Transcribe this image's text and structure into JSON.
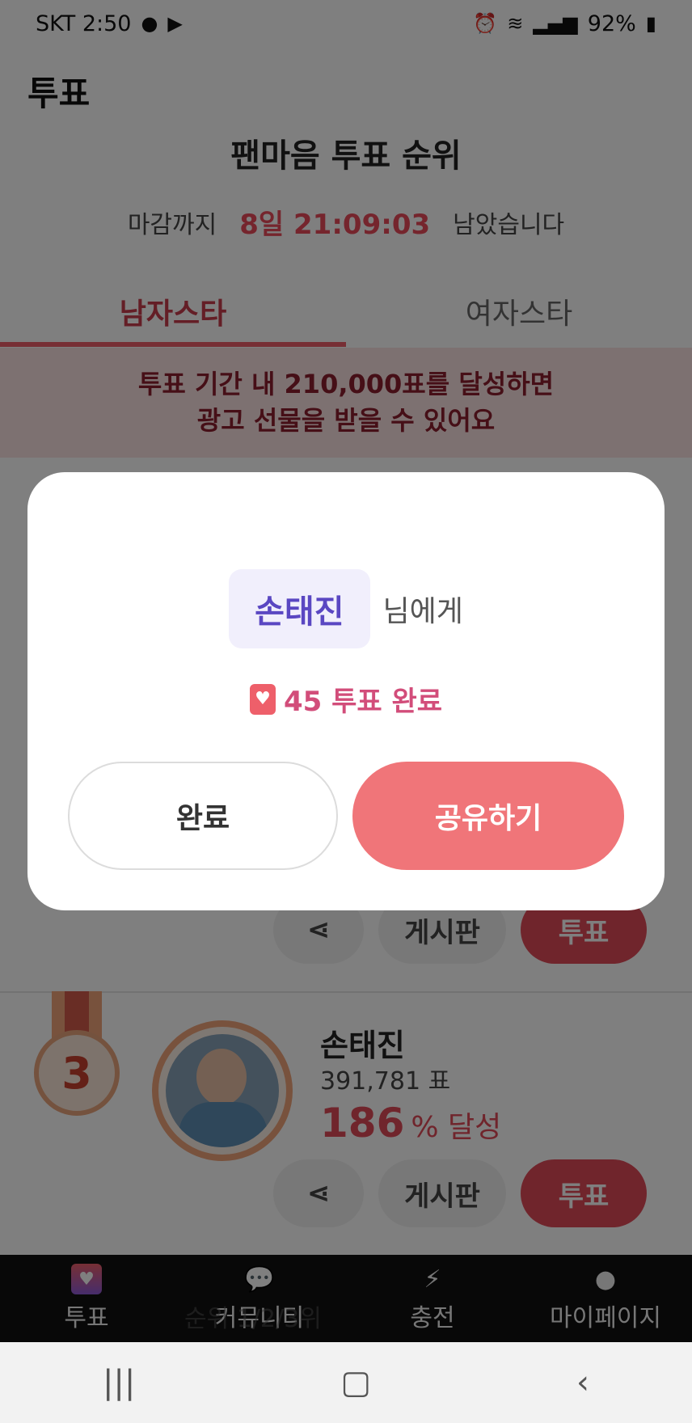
{
  "status_bar": {
    "carrier_time": "SKT 2:50",
    "battery": "92%",
    "icons": [
      "record-icon",
      "youtube-icon",
      "alarm-icon",
      "wifi-icon",
      "signal-icon",
      "battery-icon"
    ]
  },
  "header": {
    "title": "투표",
    "heading": "팬마음 투표 순위",
    "deadline_prefix": "마감까지",
    "deadline_time": "8일 21:09:03",
    "deadline_suffix": "남았습니다"
  },
  "tabs": [
    {
      "label": "남자스타",
      "active": true
    },
    {
      "label": "여자스타",
      "active": false
    }
  ],
  "banner": {
    "line1": "투표 기간 내 210,000표를 달성하면",
    "line2": "광고 선물을 받을 수 있어요"
  },
  "rank_row_prev": {
    "board_label": "게시판",
    "vote_label": "투표"
  },
  "rank_row": {
    "rank": "3",
    "name": "손태진",
    "votes": "391,781 표",
    "percent": "186",
    "percent_suffix": "% 달성",
    "board_label": "게시판",
    "vote_label": "투표"
  },
  "bottom_nav": {
    "items": [
      {
        "label": "투표",
        "icon": "heart-icon"
      },
      {
        "label": "커뮤니티",
        "icon": "chat-icon"
      },
      {
        "label": "충전",
        "icon": "shop-icon"
      },
      {
        "label": "마이페이지",
        "icon": "person-icon"
      }
    ],
    "marquee": "순위 1/2/3위"
  },
  "modal": {
    "recipient": "손태진",
    "recipient_suffix": "님에게",
    "vote_done": "45 투표 완료",
    "complete_label": "완료",
    "share_label": "공유하기"
  },
  "colors": {
    "accent": "#ee5f6a",
    "vote_button": "#e04a59",
    "share_button": "#f07579",
    "recipient_text": "#5a47c2"
  }
}
